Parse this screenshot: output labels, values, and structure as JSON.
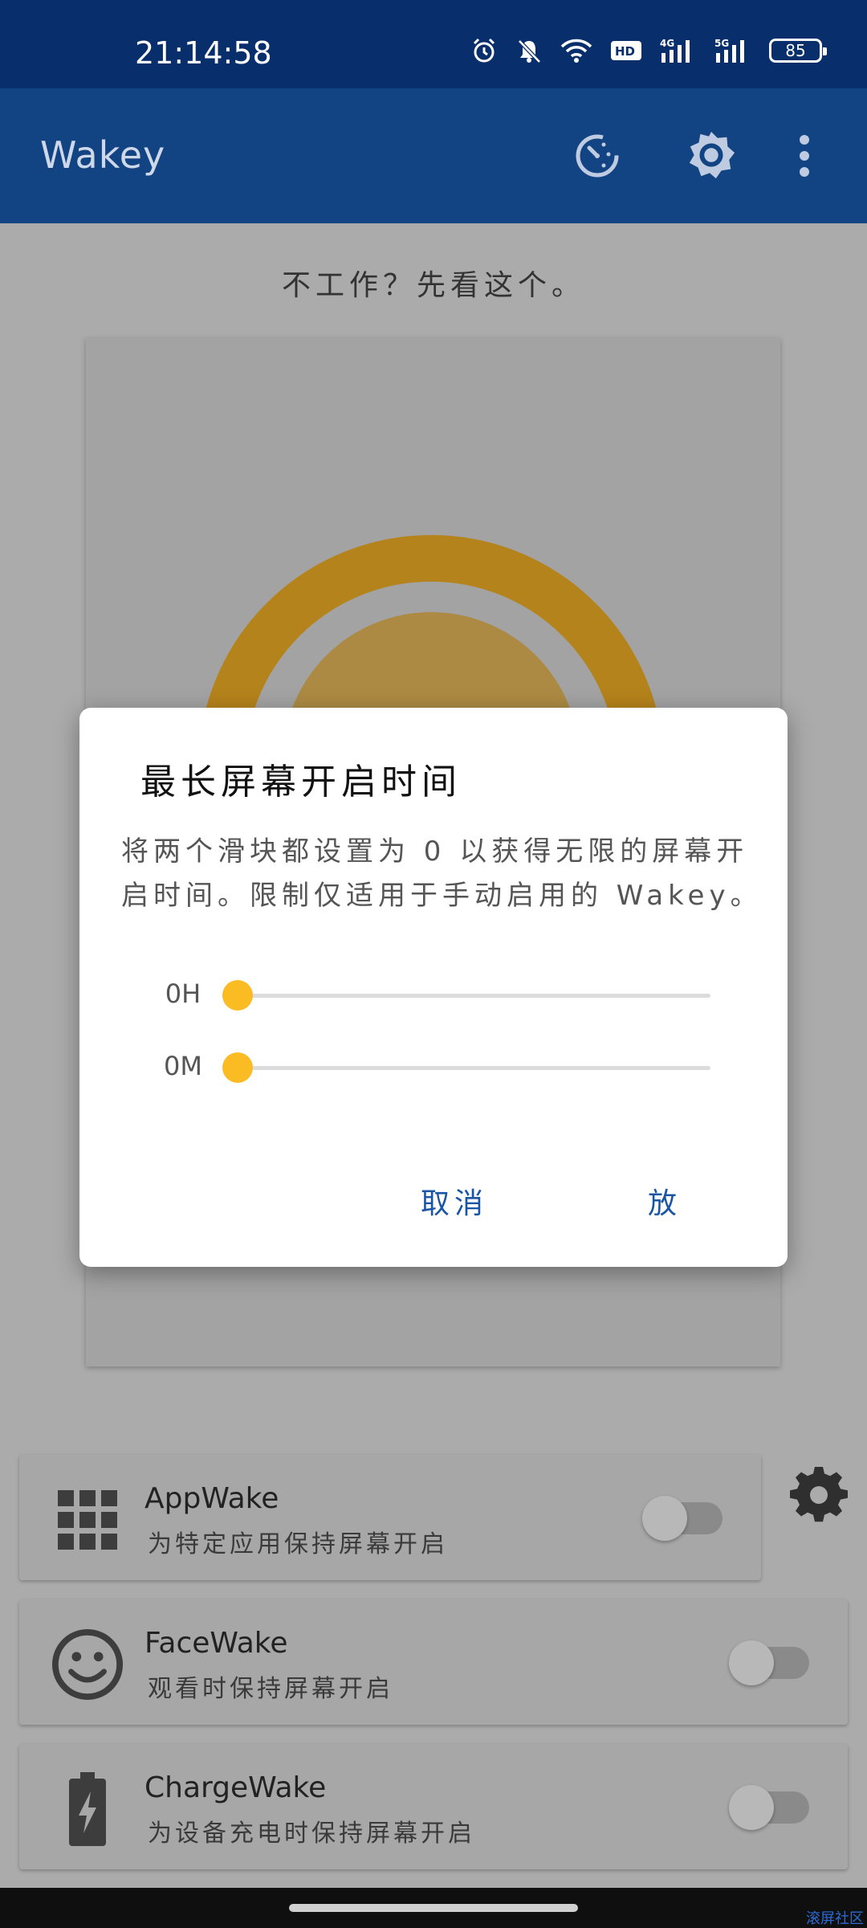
{
  "status_bar": {
    "time": "21:14:58",
    "network_1": "4G",
    "network_2": "5G",
    "battery": "85"
  },
  "app_bar": {
    "title": "Wakey"
  },
  "main": {
    "help_link": "不工作？先看这个。"
  },
  "features": [
    {
      "title": "AppWake",
      "subtitle": "为特定应用保持屏幕开启",
      "icon": "grid-icon",
      "enabled": false
    },
    {
      "title": "FaceWake",
      "subtitle": "观看时保持屏幕开启",
      "icon": "smiley-face-icon",
      "enabled": false
    },
    {
      "title": "ChargeWake",
      "subtitle": "为设备充电时保持屏幕开启",
      "icon": "battery-charging-icon",
      "enabled": false
    }
  ],
  "dialog": {
    "title": "最长屏幕开启时间",
    "message": "将两个滑块都设置为 0 以获得无限的屏幕开启时间。限制仅适用于手动启用的 Wakey。",
    "hours_label": "0H",
    "minutes_label": "0M",
    "hours_value": 0,
    "minutes_value": 0,
    "cancel_label": "取消",
    "ok_label": "放"
  },
  "watermark": "滚屏社区",
  "colors": {
    "status_bar": "#082f6b",
    "app_bar": "#124383",
    "accent": "#fbbb22",
    "dialog_button": "#1a56a3"
  }
}
